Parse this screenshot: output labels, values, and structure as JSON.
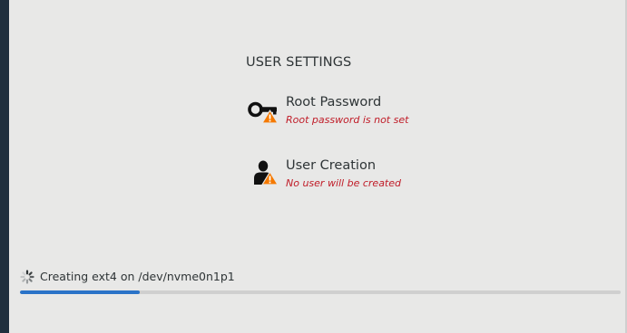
{
  "section": {
    "title": "USER SETTINGS"
  },
  "spokes": [
    {
      "title": "Root Password",
      "status": "Root password is not set",
      "icon": "key-icon",
      "badge": "warning-icon"
    },
    {
      "title": "User Creation",
      "status": "No user will be created",
      "icon": "user-icon",
      "badge": "warning-icon"
    }
  ],
  "progress": {
    "text": "Creating ext4 on /dev/nvme0n1p1",
    "fraction": 0.2
  },
  "colors": {
    "accent": "#2a73c8",
    "warning": "#f57900",
    "error_text": "#c01c28",
    "sidebar": "#1f2f3e"
  }
}
